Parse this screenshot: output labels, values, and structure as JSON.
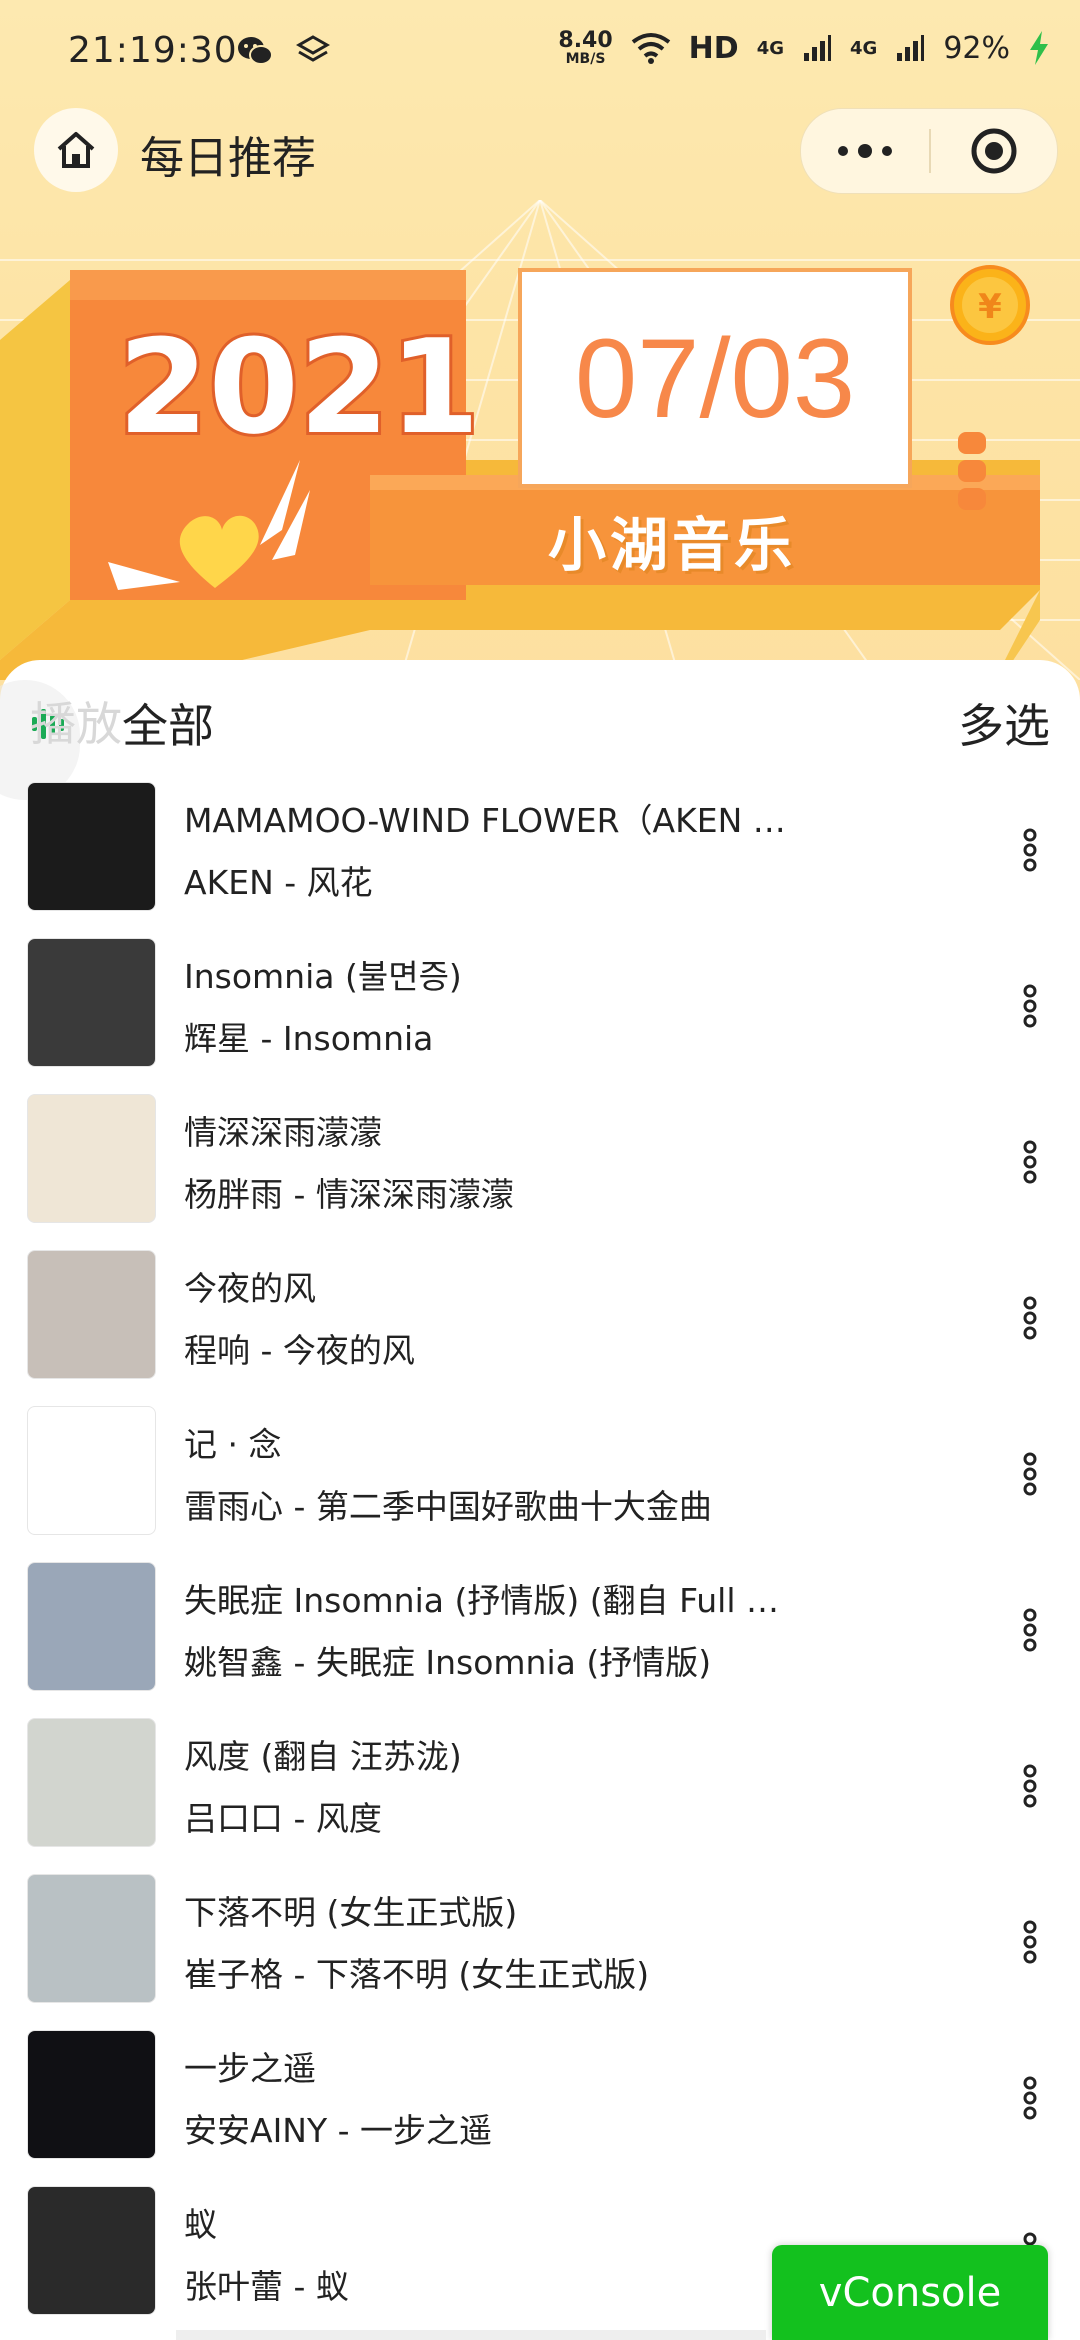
{
  "status_bar": {
    "time": "21:19:30",
    "speed_value": "8.40",
    "speed_unit": "MB/S",
    "hd": "HD",
    "net1": "4G",
    "net2": "4G",
    "battery": "92%"
  },
  "nav": {
    "title": "每日推荐"
  },
  "banner": {
    "year": "2021",
    "date": "07/03",
    "brand": "小湖音乐",
    "coin_symbol": "¥"
  },
  "toolbar": {
    "play_all": "全部",
    "play_ghost": "播放",
    "multi_select": "多选"
  },
  "songs": [
    {
      "title": "MAMAMOO-WIND FLOWER（AKEN …",
      "subtitle": "AKEN - 风花",
      "cover_color": "#1b1b1b"
    },
    {
      "title": "Insomnia (불면증)",
      "subtitle": "辉星 - Insomnia",
      "cover_color": "#3a3a3a"
    },
    {
      "title": "情深深雨濛濛",
      "subtitle": "杨胖雨 - 情深深雨濛濛",
      "cover_color": "#efe6d6"
    },
    {
      "title": "今夜的风",
      "subtitle": "程响 - 今夜的风",
      "cover_color": "#c7bfb8"
    },
    {
      "title": "记 · 念",
      "subtitle": "雷雨心 - 第二季中国好歌曲十大金曲",
      "cover_color": "#ffffff"
    },
    {
      "title": "失眠症 Insomnia (抒情版) (翻自 Full …",
      "subtitle": "姚智鑫 - 失眠症 Insomnia (抒情版)",
      "cover_color": "#9aa7b8"
    },
    {
      "title": "风度 (翻自 汪苏泷)",
      "subtitle": "吕口口 - 风度",
      "cover_color": "#d2d5cf"
    },
    {
      "title": "下落不明 (女生正式版)",
      "subtitle": "崔子格 - 下落不明 (女生正式版)",
      "cover_color": "#b9c1c4"
    },
    {
      "title": "一步之遥",
      "subtitle": "安安AINY - 一步之遥",
      "cover_color": "#101014"
    },
    {
      "title": "蚁",
      "subtitle": "张叶蕾 - 蚁",
      "cover_color": "#2a2a2a"
    }
  ],
  "vconsole": {
    "label": "vConsole"
  },
  "colors": {
    "accent_orange": "#f7884a",
    "vconsole_green": "#13c11e",
    "header_yellow": "#fde4a6"
  }
}
